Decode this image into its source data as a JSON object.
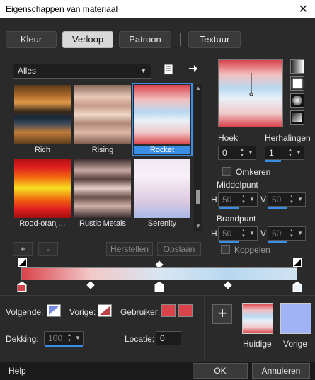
{
  "window": {
    "title": "Eigenschappen van materiaal",
    "close_glyph": "✕"
  },
  "tabs": [
    {
      "label": "Kleur",
      "active": false
    },
    {
      "label": "Verloop",
      "active": true
    },
    {
      "label": "Patroon",
      "active": false
    },
    {
      "label": "Textuur",
      "active": false
    }
  ],
  "library": {
    "category_selected": "Alles",
    "icons": [
      "book-icon",
      "arrow-right-icon"
    ],
    "gradients": [
      {
        "name": "Rich",
        "selected": false
      },
      {
        "name": "Rising",
        "selected": false
      },
      {
        "name": "Rocket",
        "selected": true
      },
      {
        "name": "Rood-oranj…",
        "selected": false
      },
      {
        "name": "Rustic Metals",
        "selected": false
      },
      {
        "name": "Serenity",
        "selected": false
      }
    ]
  },
  "style_buttons": [
    "linear-style-icon",
    "rectangular-style-icon",
    "radial-style-icon",
    "sunburst-style-icon"
  ],
  "settings": {
    "hoek_label": "Hoek",
    "hoek_value": "0",
    "herhalingen_label": "Herhalingen",
    "herhalingen_value": "1",
    "omkeren_label": "Omkeren",
    "middelpunt_label": "Middelpunt",
    "middelpunt_h": "50",
    "middelpunt_v": "50",
    "brandpunt_label": "Brandpunt",
    "brandpunt_h": "50",
    "brandpunt_v": "50",
    "koppelen_label": "Koppelen",
    "h_label": "H",
    "v_label": "V"
  },
  "editor": {
    "add_label": "+",
    "remove_label": "-",
    "herstellen_label": "Herstellen",
    "opslaan_label": "Opslaan"
  },
  "stops": {
    "volgende_label": "Volgende:",
    "vorige_label": "Vorige:",
    "gebruiker_label": "Gebruiker:",
    "dekking_label": "Dekking:",
    "dekking_value": "100",
    "locatie_label": "Locatie:",
    "locatie_value": "0"
  },
  "compare": {
    "huidige_label": "Huidige",
    "vorige_label": "Vorige"
  },
  "footer": {
    "help_label": "Help",
    "ok_label": "OK",
    "cancel_label": "Annuleren"
  },
  "colors": {
    "accent": "#3a8ee6",
    "stop_red": "#d9434a",
    "stop_lightblue": "#a8c8e8",
    "vorige_color": "#9fb3f5"
  }
}
